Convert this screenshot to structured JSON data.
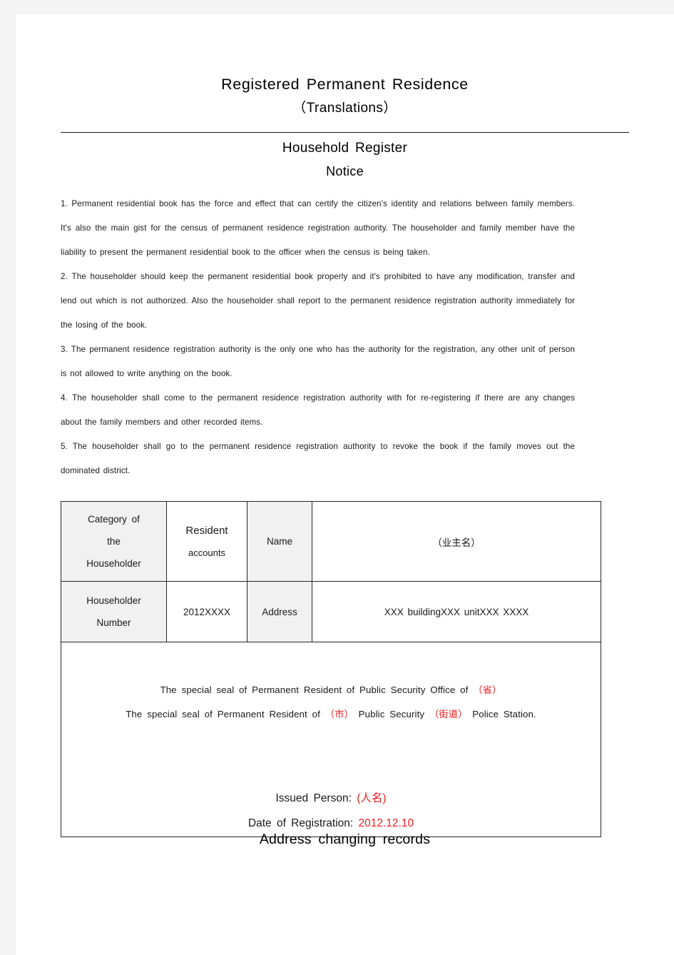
{
  "document": {
    "title": "Registered  Permanent  Residence",
    "subtitle": "（Translations）",
    "section_title": "Household  Register",
    "section_subtitle": "Notice",
    "footer_title": "Address  changing  records"
  },
  "notice": {
    "items": [
      "1. Permanent residential book has the force and effect that can certify the citizen's identity and relations between family members. It's also the main gist for the census of permanent residence registration authority. The householder and family member have the liability to present the permanent residential book to the officer when the census is being taken.",
      "2. The householder should keep the permanent residential book properly and it's prohibited to have any modification, transfer and lend out which is not authorized. Also the householder shall report to the permanent residence registration authority immediately for the losing of the book.",
      "3. The permanent residence registration authority is the only one who has the authority for the registration, any other unit of person is not allowed to write anything on the book.",
      "4. The householder shall come to the permanent residence registration authority with for re-registering if there are any changes about the family members and other recorded items.",
      "5. The householder shall go to the permanent residence registration authority to revoke the book if the family moves out the dominated district."
    ]
  },
  "table": {
    "row1": {
      "label_line1": "Category  of",
      "label_line2": "the",
      "label_line3": "Householder",
      "type_line1": "Resident",
      "type_line2": "accounts",
      "field_label": "Name",
      "field_value": "（业主名）"
    },
    "row2": {
      "label_line1": "Householder",
      "label_line2": "Number",
      "number_value": "2012XXXX",
      "field_label": "Address",
      "field_value": "XXX  buildingXXX  unitXXX  XXXX"
    },
    "seal": {
      "line1_pre": "The  special  seal  of  Permanent  Resident  of  Public  Security  Office  of  ",
      "line1_red": "（省）",
      "line2_pre": "The  special  seal  of  Permanent  Resident  of  ",
      "line2_red1": "（市）",
      "line2_mid": "  Public  Security  ",
      "line2_red2": "（街道）",
      "line2_post": "  Police  Station.",
      "issued_label": "Issued  Person: ",
      "issued_value": "(人名)",
      "date_label": "Date  of  Registration: ",
      "date_value": "2012.12.10"
    }
  },
  "colors": {
    "red_accent": "#ee1c22",
    "text": "#1a1a1a",
    "label_cell_bg": "#f1f1f1",
    "page_bg": "#ffffff",
    "canvas_bg": "#f4f4f4",
    "border": "#262626"
  }
}
